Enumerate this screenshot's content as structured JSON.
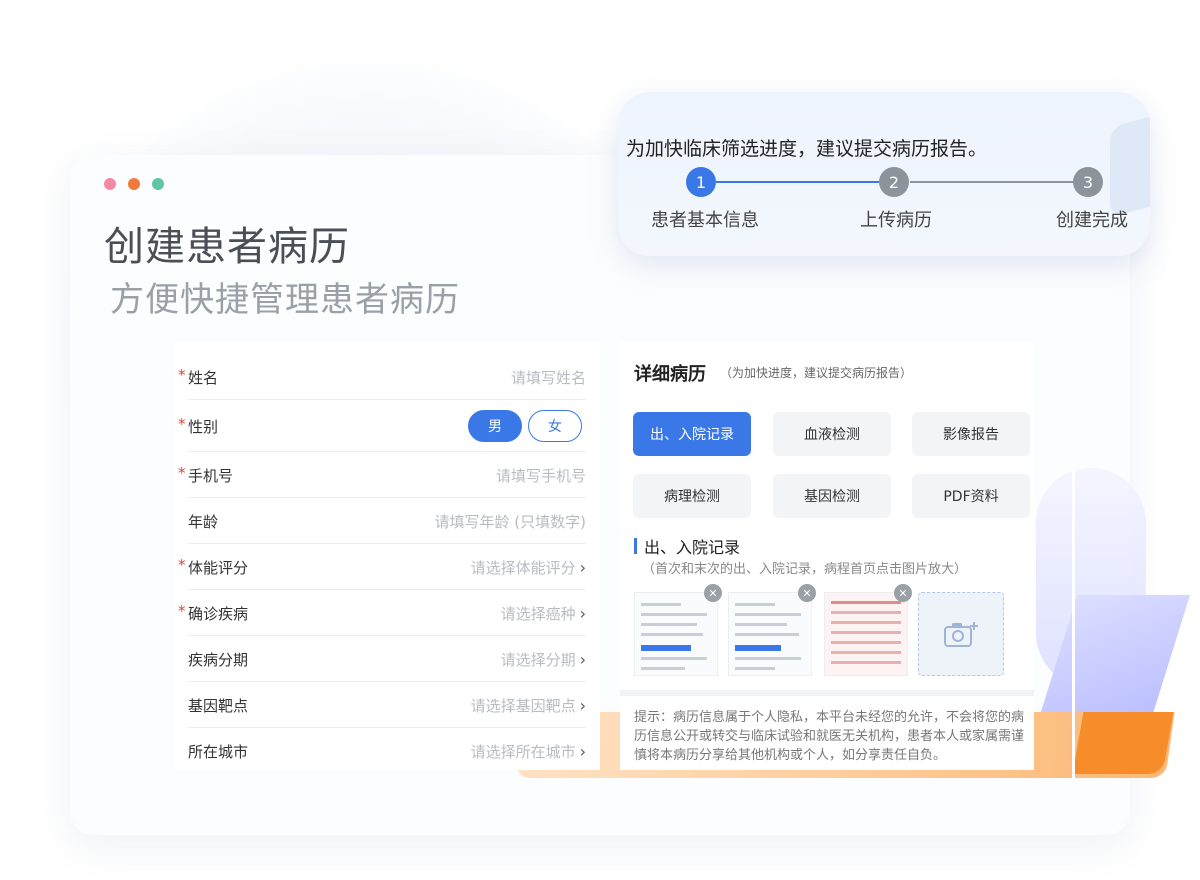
{
  "colors": {
    "accent": "#3b78e7",
    "inactive_step": "#8d939b",
    "required": "#e0463c",
    "dot_pink": "#f28aa6",
    "dot_orange": "#f07a3c",
    "dot_green": "#5fc6a2"
  },
  "hero": {
    "title": "创建患者病历",
    "subtitle": "方便快捷管理患者病历"
  },
  "stepper": {
    "hint": "为加快临床筛选进度，建议提交病历报告。",
    "steps": [
      {
        "num": "1",
        "label": "患者基本信息",
        "active": true
      },
      {
        "num": "2",
        "label": "上传病历",
        "active": false
      },
      {
        "num": "3",
        "label": "创建完成",
        "active": false
      }
    ]
  },
  "form": {
    "rows": [
      {
        "label": "姓名",
        "required": true,
        "value": "请填写姓名",
        "chevron": false
      },
      {
        "label": "性别",
        "required": true,
        "value": "",
        "chevron": false
      },
      {
        "label": "手机号",
        "required": true,
        "value": "请填写手机号",
        "chevron": false
      },
      {
        "label": "年龄",
        "required": false,
        "value": "请填写年龄 (只填数字)",
        "chevron": false
      },
      {
        "label": "体能评分",
        "required": true,
        "value": "请选择体能评分",
        "chevron": true
      },
      {
        "label": "确诊疾病",
        "required": true,
        "value": "请选择癌种",
        "chevron": true
      },
      {
        "label": "疾病分期",
        "required": false,
        "value": "请选择分期",
        "chevron": true
      },
      {
        "label": "基因靶点",
        "required": false,
        "value": "请选择基因靶点",
        "chevron": true
      },
      {
        "label": "所在城市",
        "required": false,
        "value": "请选择所在城市",
        "chevron": true
      }
    ],
    "gender": {
      "male": "男",
      "female": "女",
      "selected": "male"
    },
    "required_mark": "*"
  },
  "detail": {
    "title": "详细病历",
    "note": "（为加快进度，建议提交病历报告）",
    "categories": [
      {
        "label": "出、入院记录",
        "active": true
      },
      {
        "label": "血液检测",
        "active": false
      },
      {
        "label": "影像报告",
        "active": false
      },
      {
        "label": "病理检测",
        "active": false
      },
      {
        "label": "基因检测",
        "active": false
      },
      {
        "label": "PDF资料",
        "active": false
      }
    ],
    "section_title": "出、入院记录",
    "section_desc": "（首次和末次的出、入院记录，病程首页点击图片放大）",
    "images": [
      "record-image-1",
      "record-image-2",
      "record-image-3"
    ],
    "disclaimer": "提示：病历信息属于个人隐私，本平台未经您的允许，不会将您的病历信息公开或转交与临床试验和就医无关机构，患者本人或家属需谨慎将本病历分享给其他机构或个人，如分享责任自负。"
  }
}
